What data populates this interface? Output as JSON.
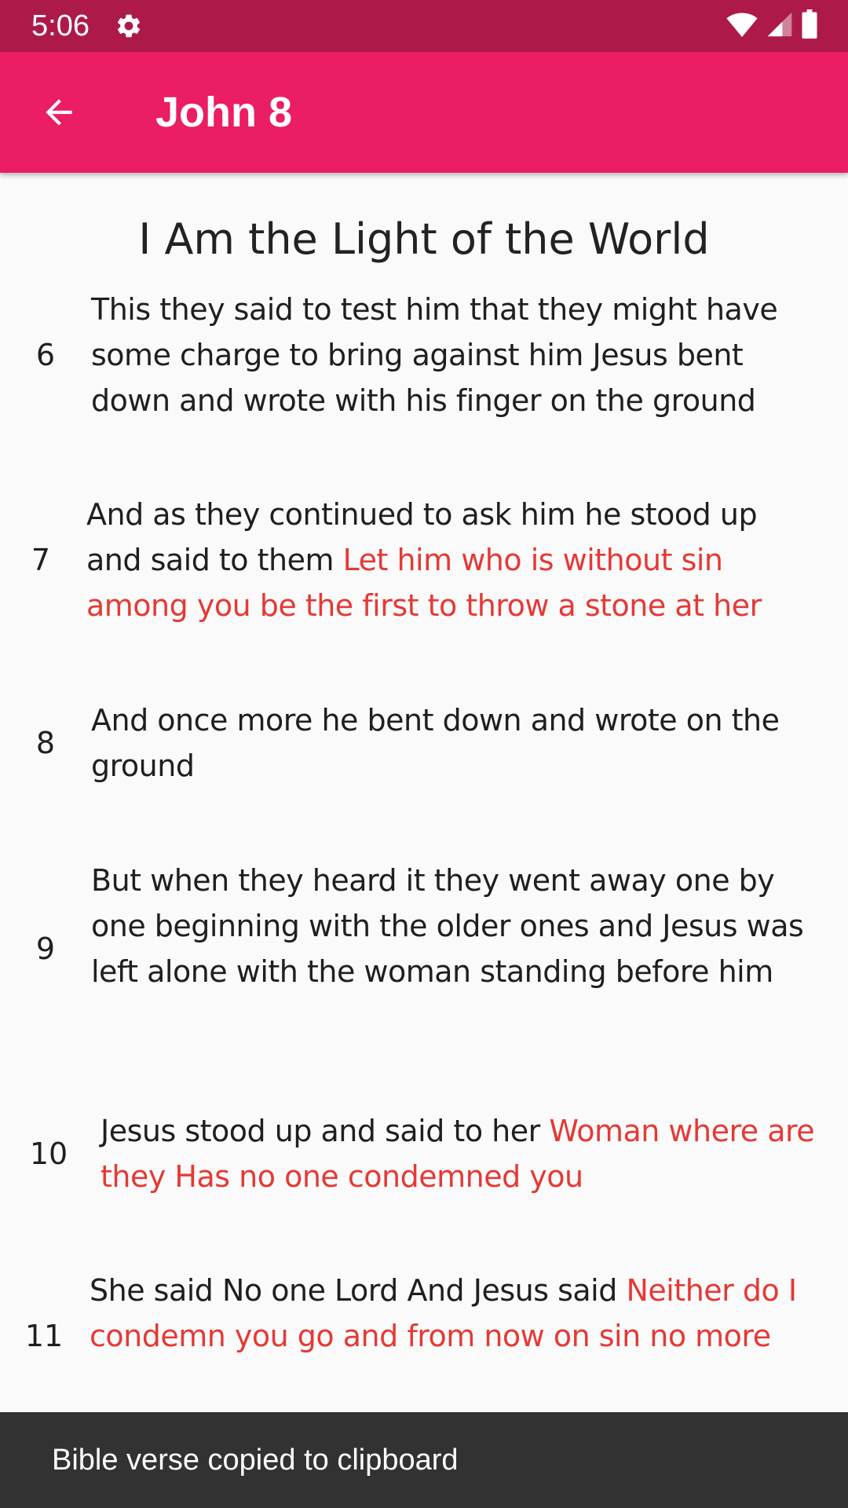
{
  "status_bar": {
    "time": "5:06",
    "icons": [
      "settings-gear-icon",
      "wifi-icon",
      "cellular-signal-icon",
      "battery-icon"
    ]
  },
  "app_bar": {
    "title": "John 8",
    "back_icon": "arrow-back-icon",
    "color": "#eb1d64"
  },
  "content": {
    "heading": "I Am the Light of the World",
    "verses": [
      {
        "number": "6",
        "text": " This they said to test him that they might have some charge to bring against him Jesus bent down and wrote with his finger on the ground",
        "red_text": ""
      },
      {
        "number": "7",
        "text": " And as they continued to ask him he stood up and said to them ",
        "red_text": "Let him who is without sin among you be the first to throw a stone at her"
      },
      {
        "number": "8",
        "text": " And once more he bent down and wrote on the ground",
        "red_text": ""
      },
      {
        "number": "9",
        "text": " But when they heard it they went away one by one beginning with the older ones and Jesus was left alone with the woman standing before him",
        "red_text": ""
      },
      {
        "number": "10",
        "text": " Jesus stood up and said to her ",
        "red_text": "Woman where are they Has no one condemned you"
      },
      {
        "number": "11",
        "text": " She said No one Lord And Jesus said ",
        "red_text": "Neither do I condemn you go and from now on sin no more"
      }
    ],
    "red_letter_color": "#e53935"
  },
  "snackbar": {
    "message": "Bible verse copied to clipboard"
  }
}
